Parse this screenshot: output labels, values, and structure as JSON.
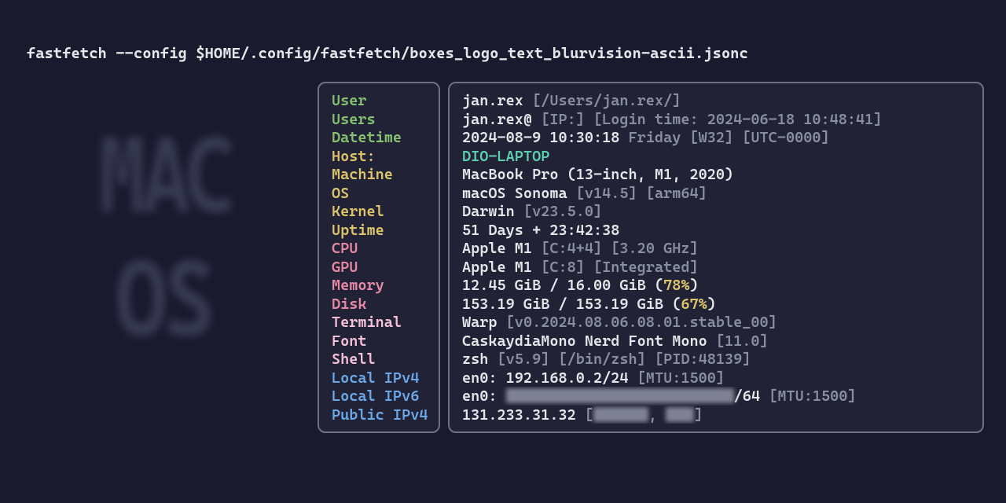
{
  "command": "fastfetch --config $HOME/.config/fastfetch/boxes_logo_text_blurvision-ascii.jsonc",
  "logo": {
    "line1": "MAC",
    "line2": "OS"
  },
  "keys": {
    "user": "User",
    "users": "Users",
    "datetime": "Datetime",
    "host": "Host:",
    "machine": "Machine",
    "os": "OS",
    "kernel": "Kernel",
    "uptime": "Uptime",
    "cpu": "CPU",
    "gpu": "GPU",
    "memory": "Memory",
    "disk": "Disk",
    "terminal": "Terminal",
    "font": "Font",
    "shell": "Shell",
    "lipv4": "Local IPv4",
    "lipv6": "Local IPv6",
    "pipv4": "Public IPv4"
  },
  "vals": {
    "user_name": "jan.rex",
    "user_path": "[/Users/jan.rex/]",
    "users_name": "jan.rex@",
    "users_ip": "[IP:]",
    "users_login": "[Login time: 2024-06-18 10:48:41]",
    "dt_date": "2024-08-9  10:30:18",
    "dt_day": "Friday",
    "dt_week": "[W32]",
    "dt_tz": "[UTC-0000]",
    "host": "DIO-LAPTOP",
    "machine": "MacBook Pro (13-inch, M1, 2020)",
    "os_name": "macOS Sonoma",
    "os_ver": "[v14.5]",
    "os_arch": "[arm64]",
    "kernel_name": "Darwin",
    "kernel_ver": "[v23.5.0]",
    "uptime": "51 Days + 23:42:38",
    "cpu_name": "Apple M1",
    "cpu_cores": "[C:4+4]",
    "cpu_freq": "[3.20 GHz]",
    "gpu_name": "Apple M1",
    "gpu_cores": "[C:8]",
    "gpu_type": "[Integrated]",
    "mem_used": "12.45 GiB / 16.00 GiB (",
    "mem_pct": "78%",
    "mem_close": ")",
    "disk_used": "153.19 GiB / 153.19 GiB (",
    "disk_pct": "67%",
    "disk_close": ")",
    "term_name": "Warp",
    "term_ver": "[v0.2024.08.06.08.01.stable_00]",
    "font_name": "CaskaydiaMono Nerd Font Mono",
    "font_size": "[11.0]",
    "shell_name": "zsh",
    "shell_ver": "[v5.9]",
    "shell_path": "[/bin/zsh]",
    "shell_pid": "[PID:48139]",
    "lipv4_if": "en0: 192.168.0.2/24",
    "lipv4_mtu": "[MTU:1500]",
    "lipv6_if": "en0:",
    "lipv6_suffix": "/64",
    "lipv6_mtu": "[MTU:1500]",
    "pipv4_ip": "131.233.31.32",
    "pipv4_open": "[",
    "pipv4_sep": ", ",
    "pipv4_close": "]"
  }
}
